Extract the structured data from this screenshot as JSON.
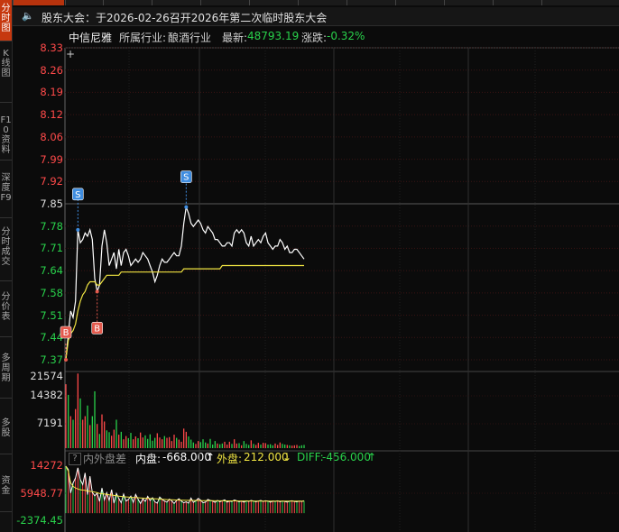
{
  "nav": {
    "items": [
      {
        "label": "分时图",
        "top": 0,
        "height": 42,
        "active": true
      },
      {
        "label": "K线图",
        "top": 50,
        "height": 60,
        "active": false
      },
      {
        "label": "F10资料",
        "top": 124,
        "height": 50,
        "active": false
      },
      {
        "label": "深度F9",
        "top": 188,
        "height": 50,
        "active": false
      },
      {
        "label": "分时成交",
        "top": 248,
        "height": 60,
        "active": false
      },
      {
        "label": "分价表",
        "top": 320,
        "height": 50,
        "active": false
      },
      {
        "label": "多周期",
        "top": 388,
        "height": 50,
        "active": false
      },
      {
        "label": "多股",
        "top": 460,
        "height": 40,
        "active": false
      },
      {
        "label": "资金",
        "top": 524,
        "height": 40,
        "active": false
      }
    ]
  },
  "notice": {
    "icon": "speaker-icon",
    "text": "股东大会：于2026-02-26召开2026年第二次临时股东大会"
  },
  "info": {
    "name": "中信尼雅",
    "industry_label": "所属行业:",
    "industry": "酿酒行业",
    "latest_label": "最新:",
    "latest": "48793.19",
    "change_label": "涨跌:",
    "change": "-0.32%"
  },
  "colors": {
    "up": "#ff4a4a",
    "down": "#29d14b",
    "price_line": "#ffffff",
    "avg_line": "#f0e442",
    "grid": "#3a1414",
    "buy_marker": "#e45a4d",
    "sell_marker": "#3f8de0"
  },
  "price_axis": {
    "ticks": [
      "8.33",
      "8.26",
      "8.19",
      "8.12",
      "8.06",
      "7.99",
      "7.92",
      "7.85",
      "7.78",
      "7.71",
      "7.64",
      "7.58",
      "7.51",
      "7.44",
      "7.37"
    ],
    "ref_price": "7.85"
  },
  "volume_axis": {
    "ticks": [
      "21574",
      "14382",
      "7191"
    ]
  },
  "diff_panel": {
    "question": "?",
    "title": "内外盘差",
    "inner_label": "内盘:",
    "inner_value": "-668.000",
    "inner_arrow": "↑",
    "outer_label": "外盘:",
    "outer_value": "212.000",
    "outer_arrow": "↓",
    "diff_label": "DIFF:",
    "diff_value": "-456.000",
    "diff_arrow": "↑",
    "ticks": [
      "14272",
      "5948.77",
      "-2374.45"
    ]
  },
  "markers": [
    {
      "type": "S",
      "label": "S"
    },
    {
      "type": "S",
      "label": "S"
    },
    {
      "type": "B",
      "label": "B"
    },
    {
      "type": "B",
      "label": "B"
    }
  ],
  "chart_data": {
    "type": "line",
    "price": [
      7.37,
      7.45,
      7.52,
      7.5,
      7.55,
      7.77,
      7.73,
      7.74,
      7.76,
      7.75,
      7.77,
      7.74,
      7.62,
      7.58,
      7.6,
      7.72,
      7.77,
      7.73,
      7.66,
      7.68,
      7.7,
      7.65,
      7.71,
      7.66,
      7.7,
      7.71,
      7.69,
      7.66,
      7.67,
      7.68,
      7.67,
      7.68,
      7.7,
      7.69,
      7.68,
      7.66,
      7.64,
      7.61,
      7.63,
      7.66,
      7.68,
      7.67,
      7.67,
      7.68,
      7.69,
      7.7,
      7.69,
      7.69,
      7.72,
      7.79,
      7.84,
      7.82,
      7.79,
      7.78,
      7.79,
      7.8,
      7.79,
      7.77,
      7.76,
      7.78,
      7.77,
      7.76,
      7.74,
      7.74,
      7.73,
      7.72,
      7.72,
      7.73,
      7.73,
      7.72,
      7.76,
      7.77,
      7.76,
      7.77,
      7.76,
      7.73,
      7.72,
      7.75,
      7.72,
      7.73,
      7.74,
      7.73,
      7.75,
      7.76,
      7.73,
      7.72,
      7.71,
      7.72,
      7.72,
      7.74,
      7.73,
      7.71,
      7.72,
      7.7,
      7.7,
      7.71,
      7.71,
      7.7,
      7.69,
      7.68
    ],
    "avg": [
      7.37,
      7.43,
      7.45,
      7.46,
      7.48,
      7.52,
      7.55,
      7.57,
      7.58,
      7.6,
      7.61,
      7.61,
      7.61,
      7.6,
      7.6,
      7.61,
      7.62,
      7.63,
      7.63,
      7.63,
      7.63,
      7.63,
      7.63,
      7.64,
      7.64,
      7.64,
      7.64,
      7.64,
      7.64,
      7.64,
      7.64,
      7.64,
      7.64,
      7.64,
      7.64,
      7.64,
      7.64,
      7.64,
      7.64,
      7.64,
      7.64,
      7.64,
      7.64,
      7.64,
      7.64,
      7.64,
      7.64,
      7.64,
      7.64,
      7.65,
      7.65,
      7.65,
      7.65,
      7.65,
      7.65,
      7.65,
      7.65,
      7.65,
      7.65,
      7.65,
      7.65,
      7.65,
      7.65,
      7.65,
      7.65,
      7.66,
      7.66,
      7.66,
      7.66,
      7.66,
      7.66,
      7.66,
      7.66,
      7.66,
      7.66,
      7.66,
      7.66,
      7.66,
      7.66,
      7.66,
      7.66,
      7.66,
      7.66,
      7.66,
      7.66,
      7.66,
      7.66,
      7.66,
      7.66,
      7.66,
      7.66,
      7.66,
      7.66,
      7.66,
      7.66,
      7.66,
      7.66,
      7.66,
      7.66,
      7.66
    ],
    "volume": [
      18000,
      15000,
      9000,
      8000,
      11000,
      21000,
      14000,
      8000,
      9000,
      12000,
      6500,
      9000,
      16000,
      6800,
      4000,
      9500,
      7500,
      5000,
      4500,
      3500,
      5200,
      8000,
      3800,
      4600,
      2500,
      3400,
      2800,
      4300,
      2500,
      3300,
      2800,
      4400,
      3000,
      3600,
      2600,
      3900,
      2100,
      2900,
      4200,
      3000,
      2500,
      3400,
      2900,
      3100,
      2000,
      3800,
      2900,
      2400,
      1800,
      5500,
      4600,
      3300,
      2400,
      1600,
      1200,
      2000,
      1700,
      2500,
      1600,
      1300,
      2600,
      1000,
      2000,
      1300,
      1100,
      1300,
      1800,
      1000,
      1800,
      1200,
      2500,
      1300,
      1400,
      800,
      2000,
      1200,
      900,
      2200,
      1200,
      900,
      1500,
      1000,
      1500,
      1400,
      1000,
      1100,
      800,
      1300,
      900,
      1600,
      1200,
      1000,
      900,
      800,
      700,
      800,
      900,
      600,
      800,
      900
    ],
    "vol_up": [
      1,
      0,
      1,
      0,
      1,
      1,
      0,
      1,
      1,
      0,
      1,
      0,
      0,
      1,
      0,
      1,
      1,
      0,
      0,
      1,
      1,
      0,
      1,
      0,
      1,
      1,
      0,
      0,
      1,
      1,
      0,
      1,
      1,
      0,
      0,
      0,
      0,
      0,
      1,
      1,
      1,
      0,
      1,
      1,
      1,
      1,
      0,
      1,
      1,
      1,
      1,
      0,
      0,
      0,
      1,
      1,
      0,
      0,
      0,
      1,
      0,
      0,
      0,
      1,
      0,
      0,
      1,
      1,
      1,
      0,
      1,
      1,
      0,
      1,
      0,
      0,
      0,
      1,
      0,
      1,
      1,
      0,
      1,
      1,
      0,
      0,
      0,
      1,
      1,
      1,
      0,
      0,
      1,
      0,
      1,
      1,
      1,
      0,
      0,
      0
    ],
    "diff": [
      14000,
      13000,
      6000,
      9000,
      10500,
      13500,
      10000,
      8500,
      12000,
      5500,
      11000,
      6200,
      5200,
      6000,
      3500,
      7500,
      4000,
      6100,
      3800,
      7000,
      3000,
      5900,
      4400,
      3100,
      5700,
      3600,
      4100,
      5100,
      3200,
      5600,
      4200,
      2900,
      4300,
      3500,
      5000,
      3800,
      4600,
      3400,
      3000,
      4800,
      4100,
      3600,
      3300,
      4200,
      3700,
      2900,
      3800,
      4300,
      3600,
      3100,
      3400,
      3000,
      4500,
      3200,
      3700,
      4400,
      3900,
      3100,
      3300,
      4100,
      3800,
      3600,
      3200,
      3800,
      3400,
      3700,
      4000,
      3300,
      3600,
      3500,
      3900,
      3700,
      3400,
      3600,
      3300,
      3700,
      3500,
      3800,
      3600,
      3400,
      3600,
      3800,
      3500,
      3700,
      3600,
      3300,
      3600,
      3500,
      3700,
      3400,
      3600,
      3500,
      3300,
      3600,
      3700,
      3500,
      3400,
      3600,
      3500,
      3700
    ],
    "diff_avg": [
      14000,
      12500,
      9000,
      8000,
      7500,
      7200,
      7000,
      6900,
      6800,
      6600,
      6500,
      6400,
      6300,
      6100,
      5900,
      5800,
      5700,
      5600,
      5500,
      5400,
      5300,
      5200,
      5100,
      5000,
      4900,
      4850,
      4800,
      4750,
      4700,
      4650,
      4600,
      4550,
      4500,
      4450,
      4400,
      4380,
      4350,
      4300,
      4250,
      4200,
      4150,
      4100,
      4050,
      4000,
      3980,
      3950,
      3920,
      3900,
      3880,
      3860,
      3840,
      3820,
      3800,
      3790,
      3780,
      3770,
      3760,
      3750,
      3740,
      3730,
      3720,
      3710,
      3700,
      3700,
      3690,
      3690,
      3680,
      3680,
      3670,
      3670,
      3660,
      3660,
      3650,
      3650,
      3640,
      3640,
      3630,
      3630,
      3620,
      3620,
      3610,
      3610,
      3600,
      3600,
      3600,
      3600,
      3600,
      3600,
      3600,
      3600,
      3600,
      3600,
      3600,
      3600,
      3600,
      3600,
      3600,
      3600,
      3600,
      3600
    ],
    "ylim": [
      7.37,
      8.33
    ],
    "vol_max": 21574,
    "diff_range": [
      -2374.45,
      14272
    ]
  }
}
